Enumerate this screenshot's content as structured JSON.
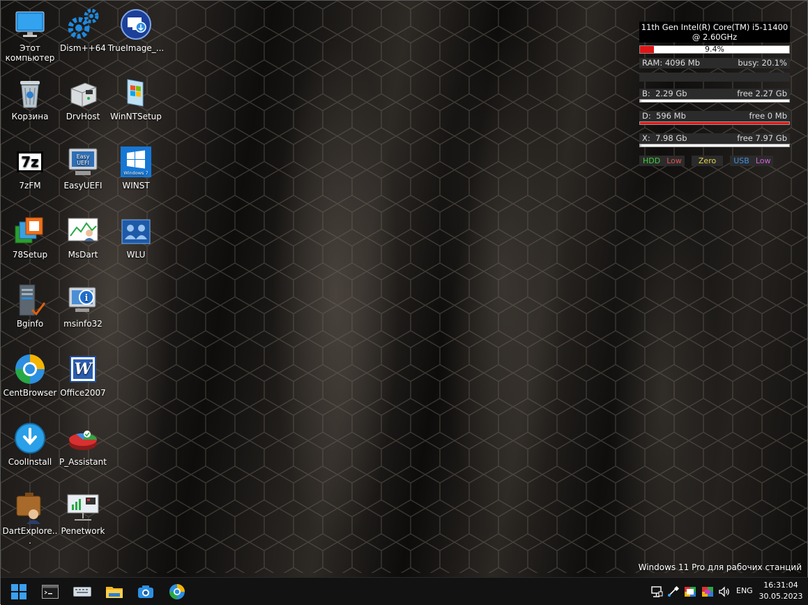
{
  "desktop_icons": [
    {
      "label": "Этот компьютер",
      "icon": "this-pc-icon"
    },
    {
      "label": "Корзина",
      "icon": "recycle-bin-icon"
    },
    {
      "label": "7zFM",
      "icon": "7zip-icon"
    },
    {
      "label": "78Setup",
      "icon": "78setup-icon"
    },
    {
      "label": "Bginfo",
      "icon": "bginfo-icon"
    },
    {
      "label": "CentBrowser",
      "icon": "centbrowser-icon"
    },
    {
      "label": "CoolInstall",
      "icon": "coolinstall-icon"
    },
    {
      "label": "DartExplore...",
      "icon": "dartexplorer-icon"
    },
    {
      "label": "Dism++64",
      "icon": "dism-icon"
    },
    {
      "label": "DrvHost",
      "icon": "drvhost-icon"
    },
    {
      "label": "EasyUEFI",
      "icon": "easyuefi-icon"
    },
    {
      "label": "MsDart",
      "icon": "msdart-icon"
    },
    {
      "label": "msinfo32",
      "icon": "msinfo32-icon"
    },
    {
      "label": "Office2007",
      "icon": "word-icon"
    },
    {
      "label": "P_Assistant",
      "icon": "partition-assistant-icon"
    },
    {
      "label": "Penetwork",
      "icon": "penetwork-icon"
    },
    {
      "label": "TrueImage_...",
      "icon": "trueimage-icon"
    },
    {
      "label": "WinNTSetup",
      "icon": "winntsetup-icon"
    },
    {
      "label": "WINST",
      "icon": "windows7-icon"
    },
    {
      "label": "WLU",
      "icon": "wlu-icon"
    }
  ],
  "icon_art": {
    "easyuefi_line1": "Easy",
    "easyuefi_line2": "UEFI",
    "winst_caption": "Windows 7",
    "sevenzip_glyph": "7z",
    "word_glyph": "W",
    "info_glyph": "i"
  },
  "meter": {
    "cpu_name": "11th Gen Intel(R) Core(TM) i5-11400 @ 2.60GHz",
    "cpu_load": "9.4%",
    "cpu_load_value": 0.094,
    "ram_label": "RAM: 4096 Mb",
    "busy_label": "busy: 20.1%",
    "drives": [
      {
        "name": "B:",
        "size": "2.29 Gb",
        "free": "free 2.27 Gb",
        "used_fraction": 0.01,
        "color": "#cfcfcf"
      },
      {
        "name": "D:",
        "size": "596 Mb",
        "free": "free 0 Mb",
        "used_fraction": 1.0,
        "color": "#e01616"
      },
      {
        "name": "X:",
        "size": "7.98 Gb",
        "free": "free 7.97 Gb",
        "used_fraction": 0.01,
        "color": "#cfcfcf"
      }
    ],
    "legend": [
      {
        "text": "HDD",
        "color": "#3ecf3e"
      },
      {
        "text": "Low",
        "color": "#e05050"
      },
      {
        "text": "Zero",
        "color": "#e6d24a"
      },
      {
        "text": "USB",
        "color": "#3f8fe0"
      },
      {
        "text": "Low",
        "color": "#d060d0"
      }
    ]
  },
  "watermark": "Windows 11 Pro для рабочих станций",
  "taskbar": {
    "lang": "ENG",
    "time": "16:31:04",
    "date": "30.05.2023"
  }
}
